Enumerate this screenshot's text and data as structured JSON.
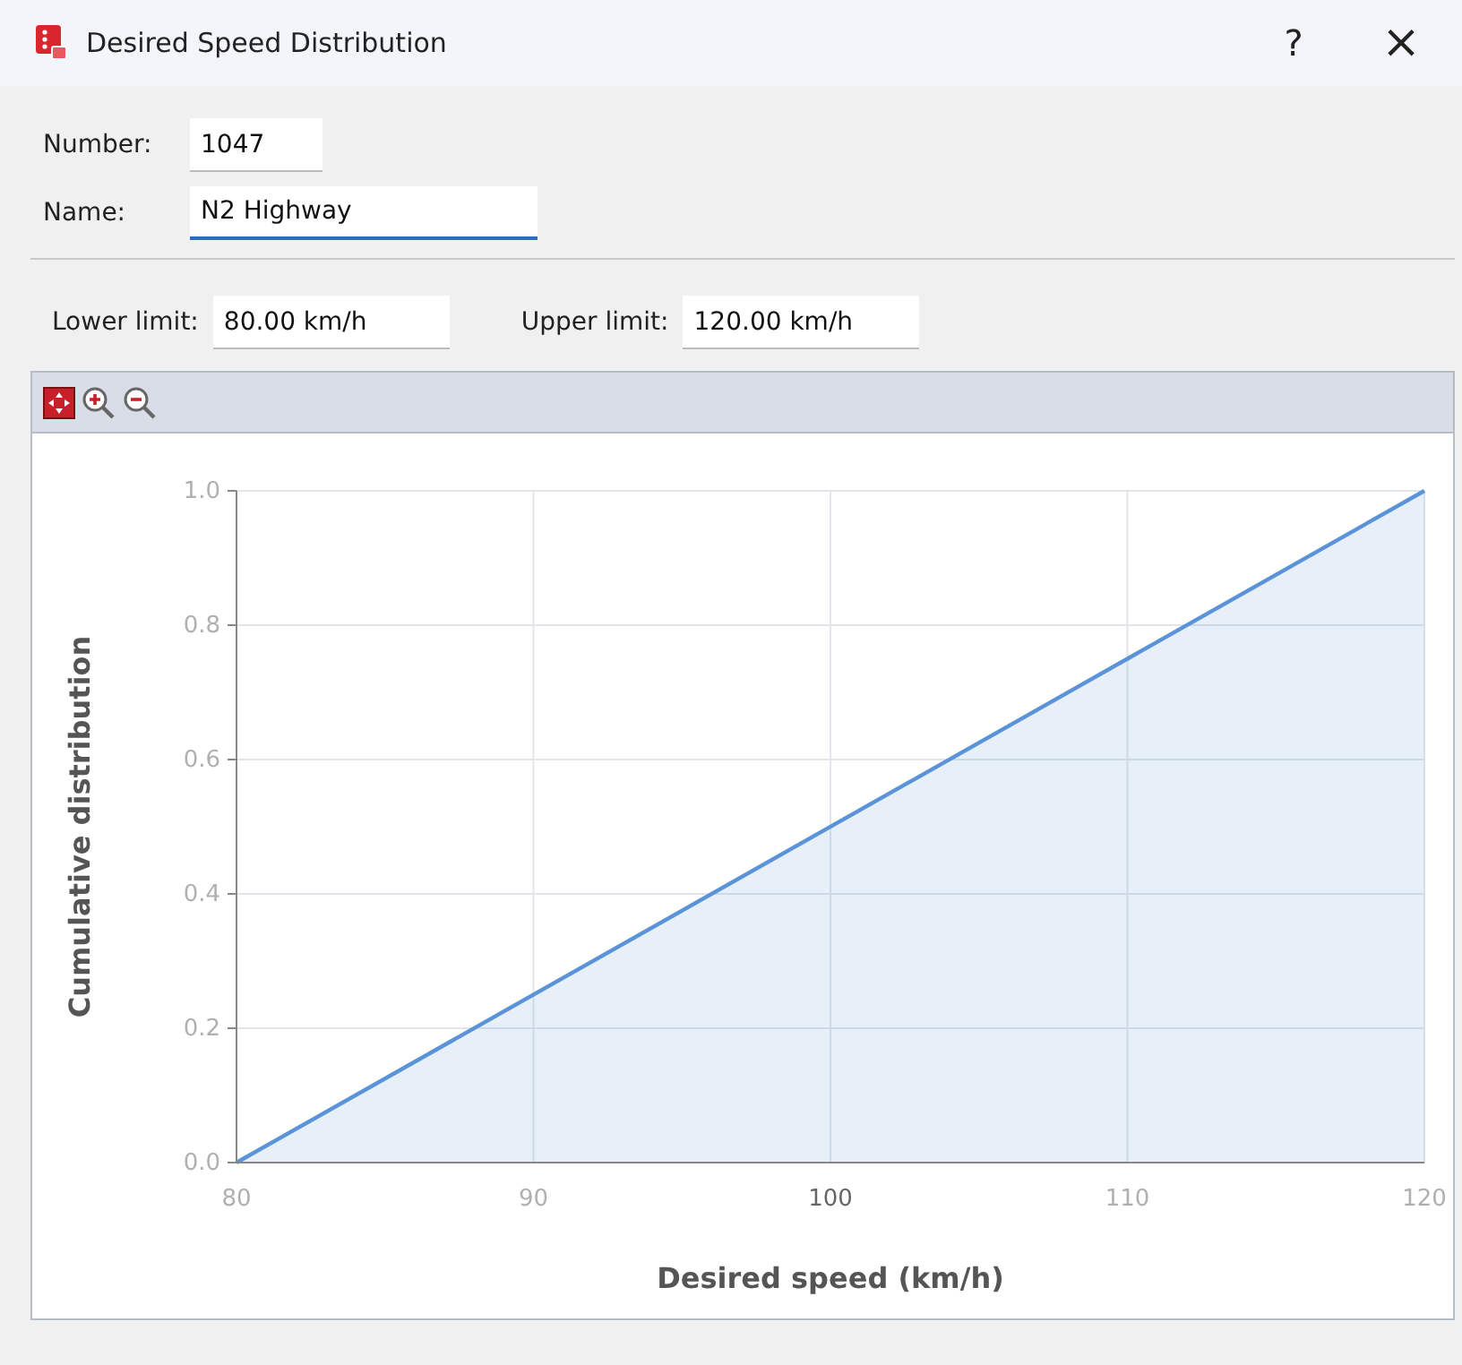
{
  "window": {
    "title": "Desired Speed Distribution",
    "help": "?",
    "close": "×"
  },
  "fields": [
    {
      "label": "Number:",
      "value": "1047",
      "focused": false
    },
    {
      "label": "Name:",
      "value": "N2 Highway",
      "focused": true
    }
  ],
  "limits": [
    {
      "label": "Lower limit:",
      "value": "80.00 km/h"
    },
    {
      "label": "Upper limit:",
      "value": "120.00 km/h"
    }
  ],
  "chart": {
    "chart_data": {
      "type": "area",
      "xlabel": "Desired speed (km/h)",
      "ylabel": "Cumulative distribution",
      "x": [
        80,
        120
      ],
      "series": [
        {
          "color": "#5b93d8",
          "values": [
            0,
            1
          ]
        }
      ],
      "grid": true,
      "xlim": [
        80,
        120
      ],
      "ylim": [
        0,
        1
      ],
      "xticks": [
        80,
        90,
        100,
        110,
        120
      ],
      "yticks": [
        {
          "value": 0,
          "label": "0.0"
        },
        {
          "value": 0.2,
          "label": "0.2"
        },
        {
          "value": 0.4,
          "label": "0.4"
        },
        {
          "value": 0.6,
          "label": "0.6"
        },
        {
          "value": 0.8,
          "label": "0.8"
        },
        {
          "value": 1,
          "label": "1.0"
        }
      ]
    }
  }
}
